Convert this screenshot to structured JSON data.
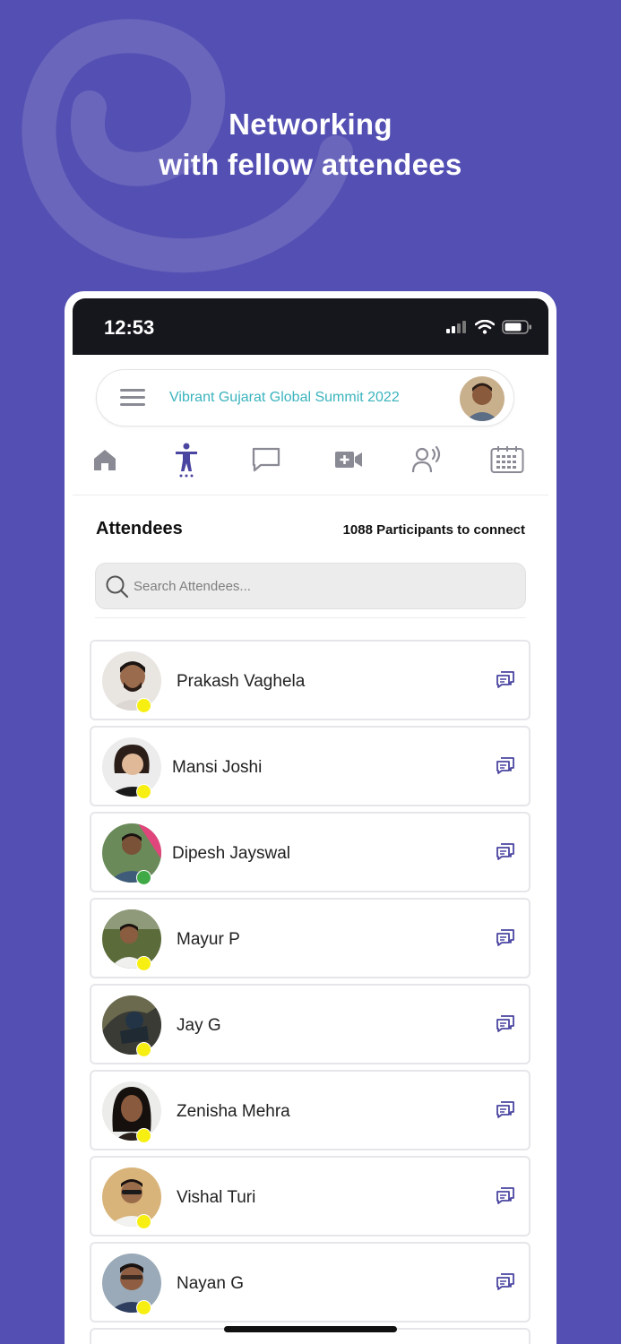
{
  "headline": {
    "line1": "Networking",
    "line2": "with fellow attendees"
  },
  "status_bar": {
    "time": "12:53",
    "icons": [
      "signal-icon",
      "wifi-icon",
      "battery-icon"
    ]
  },
  "app_bar": {
    "event_title": "Vibrant Gujarat Global Summit 2022"
  },
  "nav": [
    "home-icon",
    "attendees-icon",
    "chat-icon",
    "video-icon",
    "speaker-icon",
    "calendar-icon"
  ],
  "attendees": {
    "title": "Attendees",
    "participants_text": "1088 Participants to connect",
    "search_placeholder": "Search Attendees...",
    "list": [
      {
        "name": "Prakash Vaghela",
        "status": "away"
      },
      {
        "name": "Mansi Joshi",
        "status": "away"
      },
      {
        "name": "Dipesh Jayswal",
        "status": "online"
      },
      {
        "name": "Mayur P",
        "status": "away"
      },
      {
        "name": "Jay G",
        "status": "away"
      },
      {
        "name": "Zenisha Mehra",
        "status": "away"
      },
      {
        "name": "Vishal Turi",
        "status": "away"
      },
      {
        "name": "Nayan G",
        "status": "away"
      }
    ]
  },
  "colors": {
    "background": "#5450b3",
    "accent": "#3ab3bd",
    "nav_active": "#4a45a0",
    "away": "#f7ef12",
    "online": "#3fa945"
  }
}
